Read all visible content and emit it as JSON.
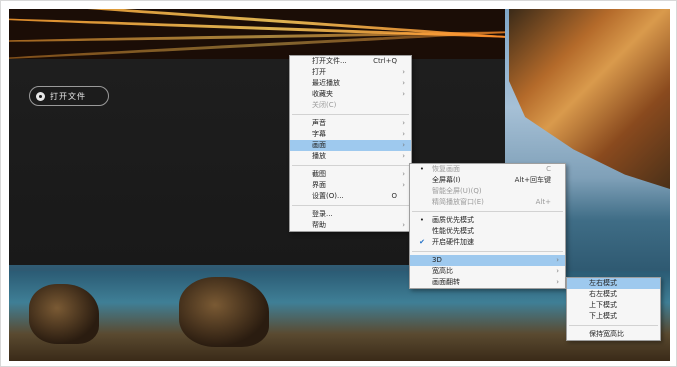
{
  "player": {
    "open_file_label": "打开文件"
  },
  "main_menu": {
    "items": [
      {
        "label": "打开文件...",
        "shortcut": "Ctrl+Q",
        "submenu": false,
        "disabled": false
      },
      {
        "label": "打开",
        "shortcut": "",
        "submenu": true,
        "disabled": false
      },
      {
        "label": "最近播放",
        "shortcut": "",
        "submenu": true,
        "disabled": false
      },
      {
        "label": "收藏夹",
        "shortcut": "",
        "submenu": true,
        "disabled": false
      },
      {
        "label": "关闭(C)",
        "shortcut": "",
        "submenu": false,
        "disabled": true
      },
      {
        "separator": true
      },
      {
        "label": "声音",
        "shortcut": "",
        "submenu": true,
        "disabled": false
      },
      {
        "label": "字幕",
        "shortcut": "",
        "submenu": true,
        "disabled": false
      },
      {
        "label": "画面",
        "shortcut": "",
        "submenu": true,
        "disabled": false,
        "highlighted": true
      },
      {
        "label": "播放",
        "shortcut": "",
        "submenu": true,
        "disabled": false
      },
      {
        "separator": true
      },
      {
        "label": "截图",
        "shortcut": "",
        "submenu": true,
        "disabled": false
      },
      {
        "label": "界面",
        "shortcut": "",
        "submenu": true,
        "disabled": false
      },
      {
        "label": "设置(O)...",
        "shortcut": "O",
        "submenu": false,
        "disabled": false
      },
      {
        "separator": true
      },
      {
        "label": "登录...",
        "shortcut": "",
        "submenu": false,
        "disabled": false
      },
      {
        "label": "帮助",
        "shortcut": "",
        "submenu": true,
        "disabled": false
      }
    ]
  },
  "picture_menu": {
    "items": [
      {
        "label": "恢复画面",
        "shortcut": "C",
        "submenu": false,
        "disabled": true,
        "mark": "dot"
      },
      {
        "label": "全屏幕(I)",
        "shortcut": "Alt+回车键",
        "submenu": false,
        "disabled": false
      },
      {
        "label": "智能全屏(U)(Q)",
        "shortcut": "",
        "submenu": false,
        "disabled": true
      },
      {
        "label": "精简播放窗口(E)",
        "shortcut": "Alt+",
        "submenu": false,
        "disabled": true
      },
      {
        "separator": true
      },
      {
        "label": "画质优先模式",
        "shortcut": "",
        "submenu": false,
        "disabled": false,
        "mark": "dot"
      },
      {
        "label": "性能优先模式",
        "shortcut": "",
        "submenu": false,
        "disabled": false
      },
      {
        "label": "开启硬件加速",
        "shortcut": "",
        "submenu": false,
        "disabled": false,
        "mark": "check"
      },
      {
        "separator": true
      },
      {
        "label": "3D",
        "shortcut": "",
        "submenu": true,
        "disabled": false,
        "highlighted": true
      },
      {
        "label": "宽高比",
        "shortcut": "",
        "submenu": true,
        "disabled": false
      },
      {
        "label": "画面翻转",
        "shortcut": "",
        "submenu": true,
        "disabled": false
      }
    ]
  },
  "menu_3d": {
    "items": [
      {
        "label": "左右模式",
        "highlighted": true
      },
      {
        "label": "右左模式"
      },
      {
        "label": "上下模式"
      },
      {
        "label": "下上模式"
      },
      {
        "separator": true
      },
      {
        "label": "保持宽高比"
      }
    ]
  },
  "colors": {
    "menu_bg": "#f6f6f6",
    "highlight": "#cfe4f8",
    "highlight_strong": "#9ec9ee",
    "check": "#1f6fc6"
  }
}
